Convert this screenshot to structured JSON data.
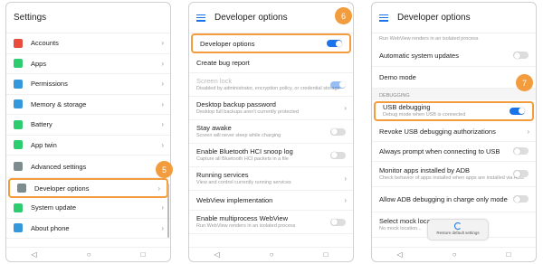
{
  "panel1": {
    "title": "Settings",
    "items": [
      {
        "label": "Accounts",
        "icon": "accounts-icon",
        "color": "#e74c3c"
      },
      {
        "label": "Apps",
        "icon": "apps-icon",
        "color": "#2ecc71"
      },
      {
        "label": "Permissions",
        "icon": "permissions-icon",
        "color": "#3498db"
      },
      {
        "label": "Memory & storage",
        "icon": "storage-icon",
        "color": "#3498db"
      },
      {
        "label": "Battery",
        "icon": "battery-icon",
        "color": "#2ecc71"
      },
      {
        "label": "App twin",
        "icon": "app-twin-icon",
        "color": "#2ecc71"
      },
      {
        "label": "Advanced settings",
        "icon": "gear-icon",
        "color": "#7f8c8d"
      },
      {
        "label": "Developer options",
        "icon": "developer-icon",
        "color": "#7f8c8d"
      },
      {
        "label": "System update",
        "icon": "update-icon",
        "color": "#2ecc71"
      },
      {
        "label": "About phone",
        "icon": "info-icon",
        "color": "#3498db"
      }
    ],
    "badge": "5"
  },
  "panel2": {
    "title": "Developer options",
    "badge": "6",
    "items": [
      {
        "label": "Developer options",
        "sub": ""
      },
      {
        "label": "Create bug report",
        "sub": ""
      },
      {
        "label": "Screen lock",
        "sub": "Disabled by administrator, encryption policy, or credential storage"
      },
      {
        "label": "Desktop backup password",
        "sub": "Desktop full backups aren't currently protected"
      },
      {
        "label": "Stay awake",
        "sub": "Screen will never sleep while charging"
      },
      {
        "label": "Enable Bluetooth HCI snoop log",
        "sub": "Capture all Bluetooth HCI packets in a file"
      },
      {
        "label": "Running services",
        "sub": "View and control currently running services"
      },
      {
        "label": "WebView implementation",
        "sub": ""
      },
      {
        "label": "Enable multiprocess WebView",
        "sub": "Run WebView renders in an isolated process"
      }
    ]
  },
  "panel3": {
    "title": "Developer options",
    "badge": "7",
    "top_sub": "Run WebView renders in an isolated process",
    "section": "DEBUGGING",
    "items_top": [
      {
        "label": "Automatic system updates"
      },
      {
        "label": "Demo mode"
      }
    ],
    "usb": {
      "label": "USB debugging",
      "sub": "Debug mode when USB is connected"
    },
    "items": [
      {
        "label": "Revoke USB debugging authorizations",
        "sub": ""
      },
      {
        "label": "Always prompt when connecting to USB",
        "sub": ""
      },
      {
        "label": "Monitor apps installed by ADB",
        "sub": "Check behavior of apps installed when apps are installed via ADB"
      },
      {
        "label": "Allow ADB debugging in charge only mode",
        "sub": ""
      },
      {
        "label": "Select mock loca...",
        "sub": "No mock location..."
      }
    ],
    "toast": "Restore default settings"
  },
  "nav": {
    "back": "◁",
    "home": "○",
    "recent": "□"
  }
}
